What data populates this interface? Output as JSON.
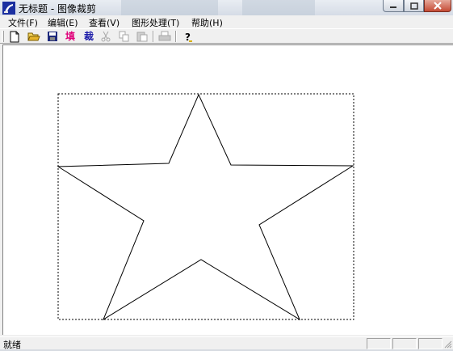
{
  "window": {
    "title": "无标题 - 图像裁剪"
  },
  "menu": [
    {
      "label": "文件(F)"
    },
    {
      "label": "编辑(E)"
    },
    {
      "label": "查看(V)"
    },
    {
      "label": "图形处理(T)"
    },
    {
      "label": "帮助(H)"
    }
  ],
  "toolbar": {
    "fill_label": "填",
    "crop_label": "裁",
    "icons": [
      "new-file-icon",
      "open-folder-icon",
      "save-disk-icon",
      "cut-icon",
      "copy-icon",
      "paste-icon",
      "print-icon",
      "help-icon"
    ],
    "colors": {
      "fill": "#e0007a",
      "crop": "#1a1aa8"
    }
  },
  "status": {
    "text": "就绪"
  }
}
